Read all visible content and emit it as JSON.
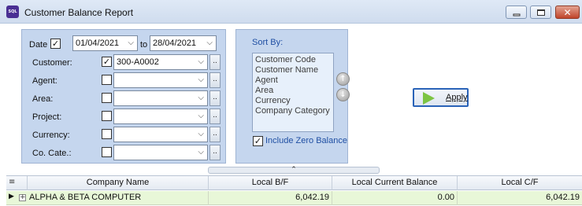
{
  "window": {
    "title": "Customer Balance Report",
    "app_icon_text": "SQL",
    "min_glyph": "",
    "close_glyph": "✕"
  },
  "filters": {
    "date_label": "Date",
    "date_checked": "✓",
    "date_from": "01/04/2021",
    "date_to_label": "to",
    "date_to": "28/04/2021",
    "rows": [
      {
        "label": "Customer:",
        "checked": "✓",
        "value": "300-A0002"
      },
      {
        "label": "Agent:",
        "checked": "",
        "value": ""
      },
      {
        "label": "Area:",
        "checked": "",
        "value": ""
      },
      {
        "label": "Project:",
        "checked": "",
        "value": ""
      },
      {
        "label": "Currency:",
        "checked": "",
        "value": ""
      },
      {
        "label": "Co. Cate.:",
        "checked": "",
        "value": ""
      }
    ],
    "dots_label": "..",
    "dropdown_glyph": "⌵"
  },
  "sort": {
    "title": "Sort By:",
    "items": [
      "Customer Code",
      "Customer Name",
      "Agent",
      "Area",
      "Currency",
      "Company Category"
    ],
    "up_glyph": "↑",
    "down_glyph": "↓",
    "include_zero_label": "Include Zero Balance",
    "include_zero_checked": "✓"
  },
  "apply": {
    "label": "Apply"
  },
  "collapse_glyph": "⌃",
  "grid": {
    "chooser_glyph": "≡",
    "columns": [
      "Company Name",
      "Local B/F",
      "Local Current Balance",
      "Local C/F"
    ],
    "rows": [
      {
        "indicator": "▶",
        "expand": "+",
        "company": "ALPHA & BETA COMPUTER",
        "bf": "6,042.19",
        "current": "0.00",
        "cf": "6,042.19"
      }
    ]
  },
  "colors": {
    "accent": "#2a63b8",
    "panel": "#c5d6ee",
    "row_highlight": "#e8f7d8",
    "apply_icon": "#7cc443"
  }
}
